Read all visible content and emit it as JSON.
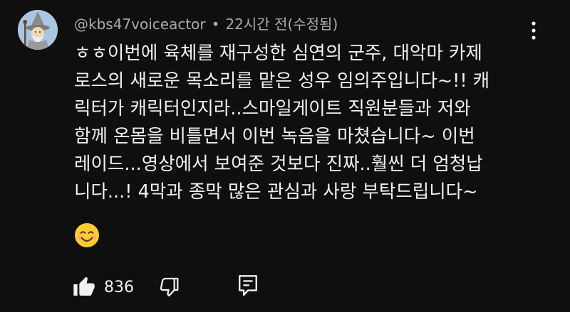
{
  "comment": {
    "author": "@kbs47voiceactor",
    "separator": "•",
    "time": "22시간 전(수정됨)",
    "lines": [
      "ㅎㅎ이번에 육체를 재구성한 심연의 군주, 대악마 카제",
      "로스의 새로운 목소리를 맡은 성우 임의주입니다~!! 캐",
      "릭터가 캐릭터인지라..스마일게이트 직원분들과 저와",
      "함께 온몸을 비틀면서 이번 녹음을 마쳤습니다~ 이번",
      "레이드...영상에서 보여준 것보다 진짜..훨씬 더 엄청납",
      "니다...! 4막과 종막 많은 관심과 사랑 부탁드립니다~"
    ],
    "emoji": "smiling-face-emoji",
    "like_count": "836"
  },
  "icons": {
    "menu": "more-vert-icon",
    "like": "thumb-up-icon",
    "dislike": "thumb-down-icon",
    "reply": "reply-comment-icon"
  },
  "colors": {
    "background": "#0f0f0f",
    "text": "#f1f1f1",
    "meta": "#aaaaaa",
    "emoji": "#ffcc33"
  }
}
